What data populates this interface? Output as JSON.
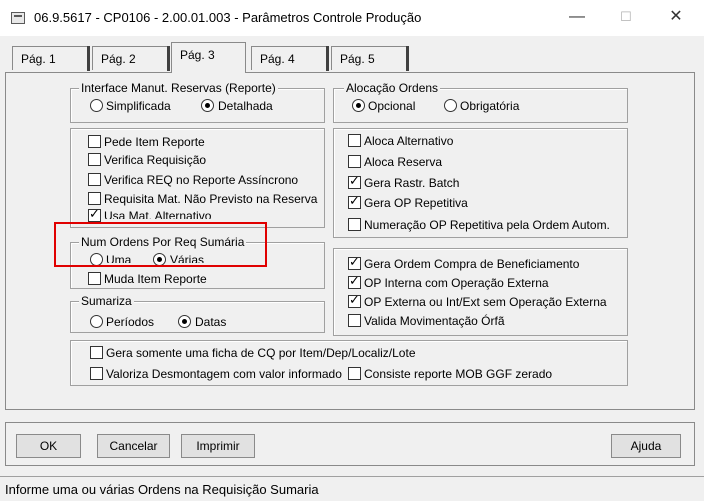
{
  "window": {
    "title": "06.9.5617 - CP0106 - 2.00.01.003 - Parâmetros Controle Produção",
    "minimize": "—",
    "maximize": "☐",
    "close": "✕"
  },
  "tabs": [
    {
      "label": "Pág. 1",
      "active": false
    },
    {
      "label": "Pág. 2",
      "active": false
    },
    {
      "label": "Pág. 3",
      "active": true
    },
    {
      "label": "Pág. 4",
      "active": false
    },
    {
      "label": "Pág. 5",
      "active": false
    }
  ],
  "interface_reservas": {
    "legend": "Interface Manut. Reservas (Reporte)",
    "options": [
      {
        "label": "Simplificada",
        "selected": false
      },
      {
        "label": "Detalhada",
        "selected": true
      }
    ]
  },
  "alocacao_ordens": {
    "legend": "Alocação Ordens",
    "options": [
      {
        "label": "Opcional",
        "selected": true
      },
      {
        "label": "Obrigatória",
        "selected": false
      }
    ]
  },
  "left_checks": [
    {
      "label": "Pede Item Reporte",
      "checked": false
    },
    {
      "label": "Verifica Requisição",
      "checked": false
    },
    {
      "label": "Verifica REQ no Reporte Assíncrono",
      "checked": false
    },
    {
      "label": "Requisita Mat. Não Previsto na Reserva",
      "checked": false
    },
    {
      "label": "Usa Mat. Alternativo",
      "checked": true
    }
  ],
  "right_checks": [
    {
      "label": "Aloca Alternativo",
      "checked": false
    },
    {
      "label": "Aloca Reserva",
      "checked": false
    },
    {
      "label": "Gera Rastr. Batch",
      "checked": true
    },
    {
      "label": "Gera OP Repetitiva",
      "checked": true
    },
    {
      "label": "Numeração OP Repetitiva pela Ordem Autom.",
      "checked": false
    }
  ],
  "num_ordens": {
    "legend": "Num Ordens Por Req Sumária",
    "options": [
      {
        "label": "Uma",
        "selected": false
      },
      {
        "label": "Várias",
        "selected": true
      }
    ],
    "muda_item": {
      "label": "Muda Item Reporte",
      "checked": false
    }
  },
  "sumariza": {
    "legend": "Sumariza",
    "options": [
      {
        "label": "Períodos",
        "selected": false
      },
      {
        "label": "Datas",
        "selected": true
      }
    ]
  },
  "right_checks_2": [
    {
      "label": "Gera Ordem Compra de Beneficiamento",
      "checked": true
    },
    {
      "label": "OP Interna com Operação Externa",
      "checked": true
    },
    {
      "label": "OP Externa ou Int/Ext sem Operação Externa",
      "checked": true
    },
    {
      "label": "Valida Movimentação Órfã",
      "checked": false
    }
  ],
  "bottom_checks": [
    {
      "label": "Gera somente uma ficha de CQ por Item/Dep/Localiz/Lote",
      "checked": false
    },
    {
      "label": "Valoriza Desmontagem com valor informado",
      "checked": false
    },
    {
      "label": "Consiste reporte MOB GGF zerado",
      "checked": false
    }
  ],
  "buttons": {
    "ok": "OK",
    "cancel": "Cancelar",
    "print": "Imprimir",
    "help": "Ajuda"
  },
  "status": "Informe uma ou várias Ordens na Requisição Sumaria",
  "colors": {
    "highlight": "#e00000",
    "panel": "#f0f0f0"
  }
}
